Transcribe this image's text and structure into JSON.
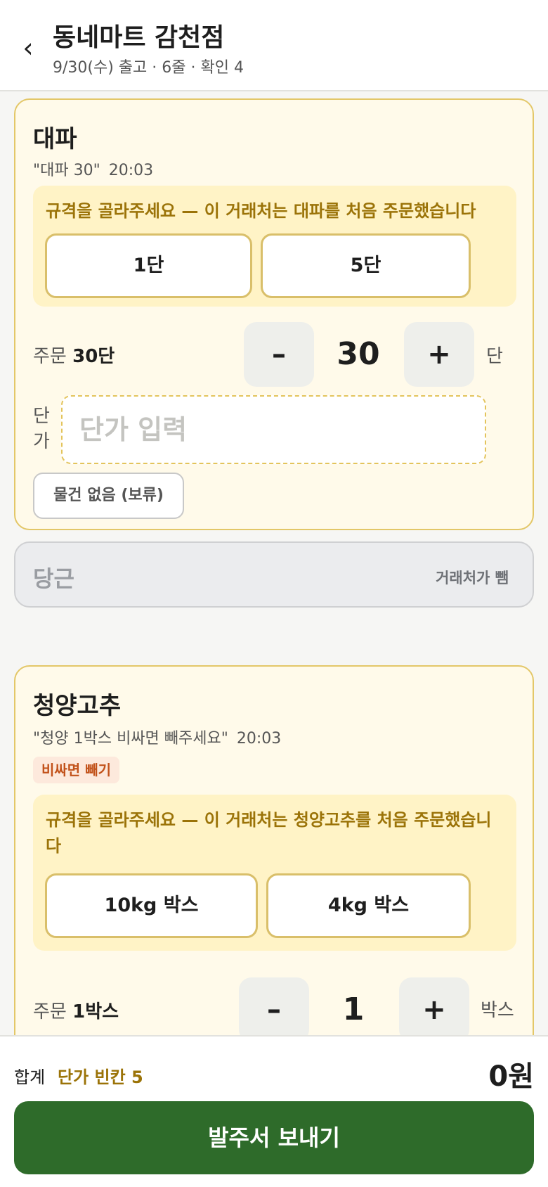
{
  "header": {
    "back_glyph": "‹",
    "title": "동네마트 감천점",
    "subtitle": "9/30(수) 출고 · 6줄 · 확인 4"
  },
  "items": [
    {
      "name": "대파",
      "quote": "\"대파 30\"",
      "time": "20:03",
      "notice": "규격을 골라주세요 — 이 거래처는 대파를 처음 주문했습니다",
      "spec_options": [
        "1단",
        "5단"
      ],
      "order_prefix": "주문",
      "order_qty_text": "30단",
      "qty": "30",
      "unit": "단",
      "price_label": "단가",
      "price_placeholder": "단가 입력",
      "price_value": "",
      "hold_label": "물건 없음 (보류)"
    },
    {
      "name": "당근",
      "excluded": true,
      "excluded_tag": "거래처가 뺌"
    },
    {
      "name": "청양고추",
      "quote": "\"청양 1박스 비싸면 빼주세요\"",
      "time": "20:03",
      "badge": "비싸면 빼기",
      "notice": "규격을 골라주세요 — 이 거래처는 청양고추를 처음 주문했습니다",
      "spec_options": [
        "10kg 박스",
        "4kg 박스"
      ],
      "order_prefix": "주문",
      "order_qty_text": "1박스",
      "qty": "1",
      "unit": "박스"
    }
  ],
  "stepper": {
    "minus": "–",
    "plus": "+"
  },
  "footer": {
    "total_label": "합계",
    "blank_price_text": "단가 빈칸 5",
    "total_amount": "0원",
    "send_label": "발주서 보내기"
  },
  "colors": {
    "primary_green": "#2e6b2a",
    "card_bg": "#fffaea",
    "card_border": "#e3c768",
    "notice_text": "#9b7308",
    "badge_text": "#c2521a"
  }
}
